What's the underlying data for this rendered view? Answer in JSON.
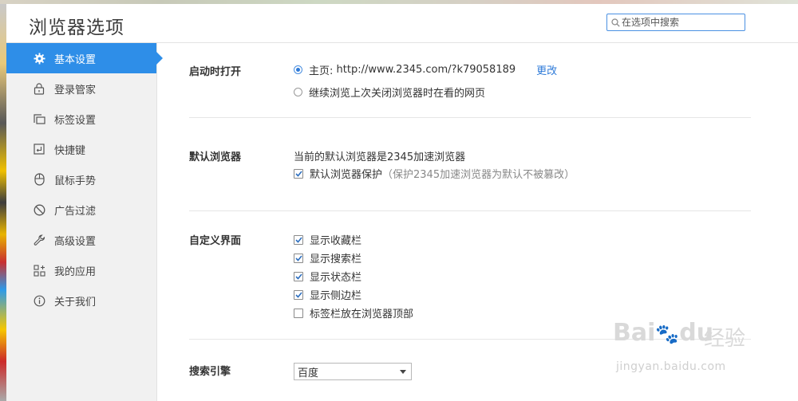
{
  "header": {
    "title": "浏览器选项",
    "search_placeholder": "在选项中搜索"
  },
  "sidebar": {
    "items": [
      {
        "label": "基本设置",
        "icon": "gear-icon",
        "active": true
      },
      {
        "label": "登录管家",
        "icon": "lock-icon"
      },
      {
        "label": "标签设置",
        "icon": "tabs-icon"
      },
      {
        "label": "快捷键",
        "icon": "shortcut-key-icon"
      },
      {
        "label": "鼠标手势",
        "icon": "mouse-icon"
      },
      {
        "label": "广告过滤",
        "icon": "block-icon"
      },
      {
        "label": "高级设置",
        "icon": "wrench-icon"
      },
      {
        "label": "我的应用",
        "icon": "apps-grid-icon"
      },
      {
        "label": "关于我们",
        "icon": "info-icon"
      }
    ]
  },
  "startup": {
    "label": "启动时打开",
    "homepage_prefix": "主页: ",
    "homepage_url": "http://www.2345.com/?k79058189",
    "change_link": "更改",
    "continue_label": "继续浏览上次关闭浏览器时在看的网页",
    "selected": "homepage"
  },
  "default_browser": {
    "label": "默认浏览器",
    "status": "当前的默认浏览器是2345加速浏览器",
    "protect_label": "默认浏览器保护",
    "protect_note": "（保护2345加速浏览器为默认不被篡改）",
    "protect_checked": true
  },
  "ui_custom": {
    "label": "自定义界面",
    "options": [
      {
        "label": "显示收藏栏",
        "checked": true
      },
      {
        "label": "显示搜索栏",
        "checked": true
      },
      {
        "label": "显示状态栏",
        "checked": true
      },
      {
        "label": "显示侧边栏",
        "checked": true
      },
      {
        "label": "标签栏放在浏览器顶部",
        "checked": false
      }
    ]
  },
  "search_engine": {
    "label": "搜索引擎",
    "selected": "百度"
  },
  "watermark": {
    "brand": "Bai",
    "brand2": "du",
    "brand_cn": "经验",
    "url": "jingyan.baidu.com"
  },
  "colors": {
    "accent": "#2e8ee8",
    "link": "#2e7ad8",
    "sidebar_bg": "#f1f1f1"
  }
}
